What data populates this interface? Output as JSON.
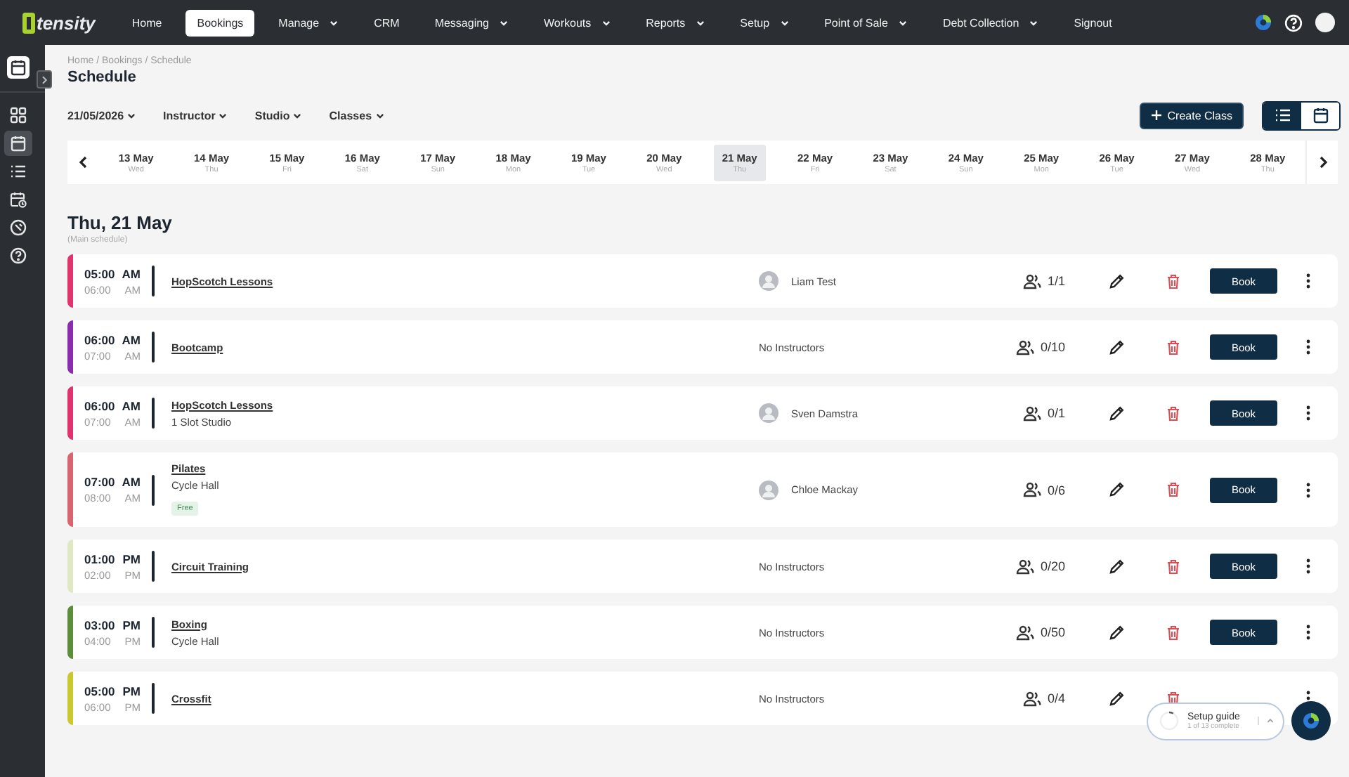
{
  "topbar": {
    "logo": "tensity",
    "nav": [
      {
        "label": "Home",
        "selected": false,
        "dropdown": false
      },
      {
        "label": "Bookings",
        "selected": true,
        "dropdown": false
      },
      {
        "label": "Manage",
        "selected": false,
        "dropdown": true
      },
      {
        "label": "CRM",
        "selected": false,
        "dropdown": false
      },
      {
        "label": "Messaging",
        "selected": false,
        "dropdown": true
      },
      {
        "label": "Workouts",
        "selected": false,
        "dropdown": true
      },
      {
        "label": "Reports",
        "selected": false,
        "dropdown": true
      },
      {
        "label": "Setup",
        "selected": false,
        "dropdown": true
      },
      {
        "label": "Point of Sale",
        "selected": false,
        "dropdown": true
      },
      {
        "label": "Debt Collection",
        "selected": false,
        "dropdown": true
      },
      {
        "label": "Signout",
        "selected": false,
        "dropdown": false
      }
    ]
  },
  "sidebar": {
    "items": [
      {
        "kind": "dashboard",
        "selected": false
      },
      {
        "kind": "calendar",
        "selected": true
      },
      {
        "kind": "list",
        "selected": false
      },
      {
        "kind": "calendar-clock",
        "selected": false
      },
      {
        "kind": "tool",
        "selected": false
      },
      {
        "kind": "help",
        "selected": false
      }
    ]
  },
  "breadcrumb": "Home / Bookings / Schedule",
  "title": "Schedule",
  "filters": [
    "21/05/2026",
    "Instructor",
    "Studio",
    "Classes"
  ],
  "create_button": "Create Class",
  "view_toggle": [
    {
      "kind": "list",
      "selected": true
    },
    {
      "kind": "calendar",
      "selected": false
    }
  ],
  "dates": [
    {
      "date": "13 May",
      "day": "Wed",
      "selected": false
    },
    {
      "date": "14 May",
      "day": "Thu",
      "selected": false
    },
    {
      "date": "15 May",
      "day": "Fri",
      "selected": false
    },
    {
      "date": "16 May",
      "day": "Sat",
      "selected": false
    },
    {
      "date": "17 May",
      "day": "Sun",
      "selected": false
    },
    {
      "date": "18 May",
      "day": "Mon",
      "selected": false
    },
    {
      "date": "19 May",
      "day": "Tue",
      "selected": false
    },
    {
      "date": "20 May",
      "day": "Wed",
      "selected": false
    },
    {
      "date": "21 May",
      "day": "Thu",
      "selected": true
    },
    {
      "date": "22 May",
      "day": "Fri",
      "selected": false
    },
    {
      "date": "23 May",
      "day": "Sat",
      "selected": false
    },
    {
      "date": "24 May",
      "day": "Sun",
      "selected": false
    },
    {
      "date": "25 May",
      "day": "Mon",
      "selected": false
    },
    {
      "date": "26 May",
      "day": "Tue",
      "selected": false
    },
    {
      "date": "27 May",
      "day": "Wed",
      "selected": false
    },
    {
      "date": "28 May",
      "day": "Thu",
      "selected": false
    }
  ],
  "day_heading": "Thu, 21 May",
  "schedule_name": "(Main schedule)",
  "classes": [
    {
      "color": "#e2346c",
      "start": "05:00",
      "start_period": "AM",
      "end": "06:00",
      "end_period": "AM",
      "name": "HopScotch Lessons",
      "instructor": {
        "kind": "person",
        "name": "Liam Test"
      },
      "capacity": "1/1",
      "book": "Book"
    },
    {
      "color": "#8a2cae",
      "start": "06:00",
      "start_period": "AM",
      "end": "07:00",
      "end_period": "AM",
      "name": "Bootcamp",
      "instructor": {
        "kind": "none",
        "name": "No Instructors"
      },
      "capacity": "0/10",
      "book": "Book"
    },
    {
      "color": "#e0336e",
      "start": "06:00",
      "start_period": "AM",
      "end": "07:00",
      "end_period": "AM",
      "name": "HopScotch Lessons",
      "location": "1 Slot Studio",
      "instructor": {
        "kind": "person",
        "name": "Sven Damstra"
      },
      "capacity": "0/1",
      "book": "Book"
    },
    {
      "color": "#d8646f",
      "start": "07:00",
      "start_period": "AM",
      "end": "08:00",
      "end_period": "AM",
      "name": "Pilates",
      "location": "Cycle Hall",
      "tag": "Free",
      "instructor": {
        "kind": "person",
        "name": "Chloe Mackay"
      },
      "capacity": "0/6",
      "book": "Book"
    },
    {
      "color": "#dfe8c2",
      "start": "01:00",
      "start_period": "PM",
      "end": "02:00",
      "end_period": "PM",
      "name": "Circuit Training",
      "instructor": {
        "kind": "none",
        "name": "No Instructors"
      },
      "capacity": "0/20",
      "book": "Book"
    },
    {
      "color": "#5c8d3a",
      "start": "03:00",
      "start_period": "PM",
      "end": "04:00",
      "end_period": "PM",
      "name": "Boxing",
      "location": "Cycle Hall",
      "instructor": {
        "kind": "none",
        "name": "No Instructors"
      },
      "capacity": "0/50",
      "book": "Book"
    },
    {
      "color": "#cbc72e",
      "start": "05:00",
      "start_period": "PM",
      "end": "06:00",
      "end_period": "PM",
      "name": "Crossfit",
      "instructor": {
        "kind": "none",
        "name": "No Instructors"
      },
      "capacity": "0/4"
    }
  ],
  "setup_guide": {
    "title": "Setup guide",
    "progress": "1 of 13 complete",
    "level": 0.08
  }
}
